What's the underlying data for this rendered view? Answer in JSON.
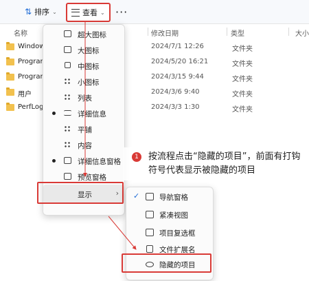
{
  "toolbar": {
    "sort_label": "排序",
    "view_label": "查看",
    "more_label": "···"
  },
  "columns": {
    "name": "名称",
    "date": "修改日期",
    "type": "类型",
    "size": "大小"
  },
  "files": [
    {
      "name": "Windows",
      "date": "2024/7/1 12:26",
      "type": "文件夹"
    },
    {
      "name": "Program",
      "date": "2024/5/20 16:21",
      "type": "文件夹"
    },
    {
      "name": "Program",
      "date": "2024/3/15 9:44",
      "type": "文件夹"
    },
    {
      "name": "用户",
      "date": "2024/3/6 9:40",
      "type": "文件夹"
    },
    {
      "name": "PerfLogs",
      "date": "2024/3/3 1:30",
      "type": "文件夹"
    }
  ],
  "view_menu": {
    "items": [
      {
        "label": "超大图标",
        "icon": "extra-large-icons-icon"
      },
      {
        "label": "大图标",
        "icon": "large-icons-icon"
      },
      {
        "label": "中图标",
        "icon": "medium-icons-icon"
      },
      {
        "label": "小图标",
        "icon": "small-icons-icon"
      },
      {
        "label": "列表",
        "icon": "list-icon"
      },
      {
        "label": "详细信息",
        "icon": "details-icon"
      },
      {
        "label": "平铺",
        "icon": "tiles-icon"
      },
      {
        "label": "内容",
        "icon": "content-icon"
      },
      {
        "label": "详细信息窗格",
        "icon": "details-pane-icon"
      },
      {
        "label": "预览窗格",
        "icon": "preview-pane-icon"
      }
    ],
    "display_label": "显示"
  },
  "display_submenu": {
    "items": [
      {
        "label": "导航窗格",
        "icon": "navigation-pane-icon"
      },
      {
        "label": "紧凑视图",
        "icon": "compact-view-icon"
      },
      {
        "label": "项目复选框",
        "icon": "checkbox-icon"
      },
      {
        "label": "文件扩展名",
        "icon": "file-extension-icon"
      },
      {
        "label": "隐藏的项目",
        "icon": "eye-icon"
      }
    ]
  },
  "annotation": {
    "number": "1",
    "text": "按流程点击“隐藏的项目”，前面有打钩符号代表显示被隐藏的项目"
  },
  "colors": {
    "highlight_red": "#d93a36",
    "accent_blue": "#1e6bd6",
    "folder_yellow": "#f2c14e"
  }
}
